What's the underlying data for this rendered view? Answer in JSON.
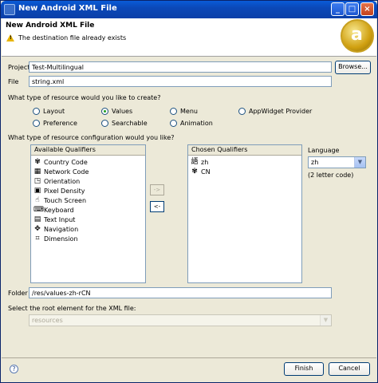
{
  "window": {
    "title": "New Android XML File"
  },
  "header": {
    "title": "New Android XML File",
    "message": "The destination file already exists"
  },
  "project": {
    "label": "Project",
    "value": "Test-Multilingual",
    "browse": "Browse..."
  },
  "file": {
    "label": "File",
    "value": "string.xml"
  },
  "resource": {
    "question": "What type of resource would you like to create?",
    "options": [
      "Layout",
      "Values",
      "Menu",
      "AppWidget Provider",
      "Preference",
      "Searchable",
      "Animation"
    ],
    "selected": "Values"
  },
  "config": {
    "question": "What type of resource configuration would you like?"
  },
  "available": {
    "header": "Available Qualifiers",
    "items": [
      {
        "label": "Country Code",
        "icon": "globe-icon"
      },
      {
        "label": "Network Code",
        "icon": "network-icon"
      },
      {
        "label": "Orientation",
        "icon": "orientation-icon"
      },
      {
        "label": "Pixel Density",
        "icon": "density-icon"
      },
      {
        "label": "Touch Screen",
        "icon": "touchscreen-icon"
      },
      {
        "label": "Keyboard",
        "icon": "keyboard-icon"
      },
      {
        "label": "Text Input",
        "icon": "text-input-icon"
      },
      {
        "label": "Navigation",
        "icon": "navigation-icon"
      },
      {
        "label": "Dimension",
        "icon": "dimension-icon"
      }
    ]
  },
  "transfer": {
    "add": "->",
    "remove": "<-"
  },
  "chosen": {
    "header": "Chosen Qualifiers",
    "items": [
      {
        "label": "zh",
        "icon": "language-icon"
      },
      {
        "label": "CN",
        "icon": "globe-icon"
      }
    ]
  },
  "language": {
    "label": "Language",
    "value": "zh",
    "hint": "(2 letter code)"
  },
  "folder": {
    "label": "Folder",
    "value": "/res/values-zh-rCN"
  },
  "root": {
    "label": "Select the root element for the XML file:",
    "value": "resources"
  },
  "footer": {
    "finish": "Finish",
    "cancel": "Cancel",
    "help": "?"
  },
  "colors": {
    "titlebar": "#0a48b8",
    "dialog_bg": "#ece9d8",
    "field_border": "#7f9db9",
    "radio_dot": "#21a121",
    "warning": "#e8b400"
  }
}
